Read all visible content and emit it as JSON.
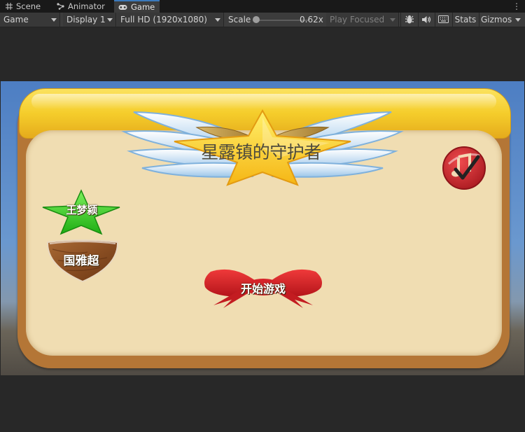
{
  "tabs": [
    {
      "label": "Scene",
      "icon": "grid-icon"
    },
    {
      "label": "Animator",
      "icon": "animator-icon"
    },
    {
      "label": "Game",
      "icon": "gamepad-icon"
    }
  ],
  "toolbar": {
    "view_dropdown": "Game",
    "display_dropdown": "Display 1",
    "resolution_dropdown": "Full HD (1920x1080)",
    "scale_label": "Scale",
    "scale_value": "0.62x",
    "scale_fraction": 0.1,
    "play_mode_dropdown": "Play Focused",
    "stats_label": "Stats",
    "gizmos_label": "Gizmos"
  },
  "game": {
    "title": "星露镇的守护者",
    "hero_button_1": "王梦颍",
    "hero_button_2": "国雅超",
    "start_button": "开始游戏",
    "music_icon": "music-note-check-icon"
  },
  "colors": {
    "editor_bg": "#282828",
    "tab_active_accent": "#3a79bb",
    "board_frame": "#b47636",
    "board_panel": "#f0ddb2",
    "board_top": "#f5cd2b",
    "ribbon": "#d51f24",
    "star_green": "#2fca1d",
    "music_button": "#c7262c"
  }
}
